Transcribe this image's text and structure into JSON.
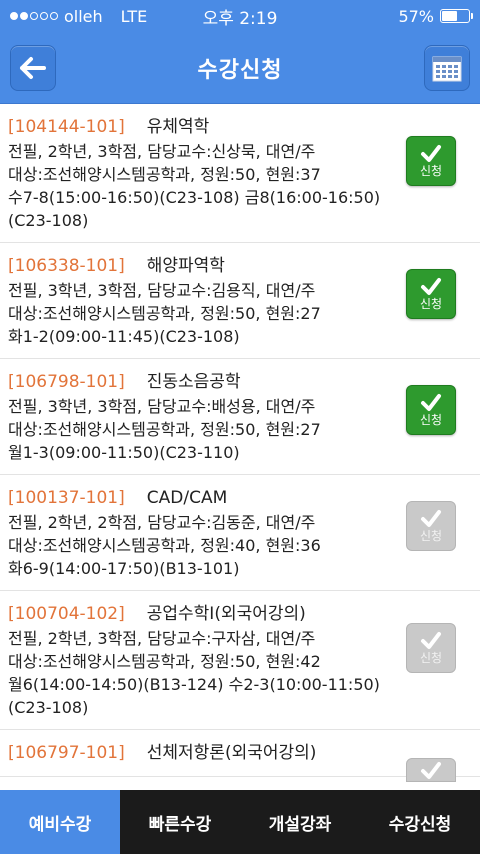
{
  "status": {
    "carrier": "olleh",
    "network": "LTE",
    "time": "오후 2:19",
    "battery": "57%",
    "battery_level": 0.57,
    "signal_bars_filled": 2,
    "signal_bars_total": 5
  },
  "header": {
    "title": "수강신청",
    "back_icon": "back-arrow-icon",
    "calendar_icon": "calendar-icon"
  },
  "courses": [
    {
      "code": "[104144-101]",
      "name": "유체역학",
      "lines": [
        "전필, 2학년, 3학점, 담당교수:신상묵, 대연/주",
        "대상:조선해양시스템공학과, 정원:50, 현원:37",
        "수7-8(15:00-16:50)(C23-108) 금8(16:00-16:50)",
        "(C23-108)"
      ],
      "button_label": "신청",
      "enabled": true
    },
    {
      "code": "[106338-101]",
      "name": "해양파역학",
      "lines": [
        "전필, 3학년, 3학점, 담당교수:김용직, 대연/주",
        "대상:조선해양시스템공학과, 정원:50, 현원:27",
        "화1-2(09:00-11:45)(C23-108)"
      ],
      "button_label": "신청",
      "enabled": true
    },
    {
      "code": "[106798-101]",
      "name": "진동소음공학",
      "lines": [
        "전필, 3학년, 3학점, 담당교수:배성용, 대연/주",
        "대상:조선해양시스템공학과, 정원:50, 현원:27",
        "월1-3(09:00-11:50)(C23-110)"
      ],
      "button_label": "신청",
      "enabled": true
    },
    {
      "code": "[100137-101]",
      "name": "CAD/CAM",
      "lines": [
        "전필, 2학년, 2학점, 담당교수:김동준, 대연/주",
        "대상:조선해양시스템공학과, 정원:40, 현원:36",
        "화6-9(14:00-17:50)(B13-101)"
      ],
      "button_label": "신청",
      "enabled": false
    },
    {
      "code": "[100704-102]",
      "name": "공업수학I(외국어강의)",
      "lines": [
        "전필, 2학년, 3학점, 담당교수:구자삼, 대연/주",
        "대상:조선해양시스템공학과, 정원:50, 현원:42",
        "월6(14:00-14:50)(B13-124) 수2-3(10:00-11:50)",
        "(C23-108)"
      ],
      "button_label": "신청",
      "enabled": false
    },
    {
      "code": "[106797-101]",
      "name": "선체저항론(외국어강의)",
      "lines": [],
      "button_label": "",
      "enabled": false
    }
  ],
  "tabs": [
    {
      "label": "예비수강",
      "active": true
    },
    {
      "label": "빠른수강",
      "active": false
    },
    {
      "label": "개설강좌",
      "active": false
    },
    {
      "label": "수강신청",
      "active": false
    }
  ],
  "colors": {
    "accent": "#4a8be5",
    "course_code": "#e2743a",
    "apply_enabled": "#2e9a2e",
    "apply_disabled": "#c9c9c9",
    "tab_bar": "#1b1b1b"
  }
}
